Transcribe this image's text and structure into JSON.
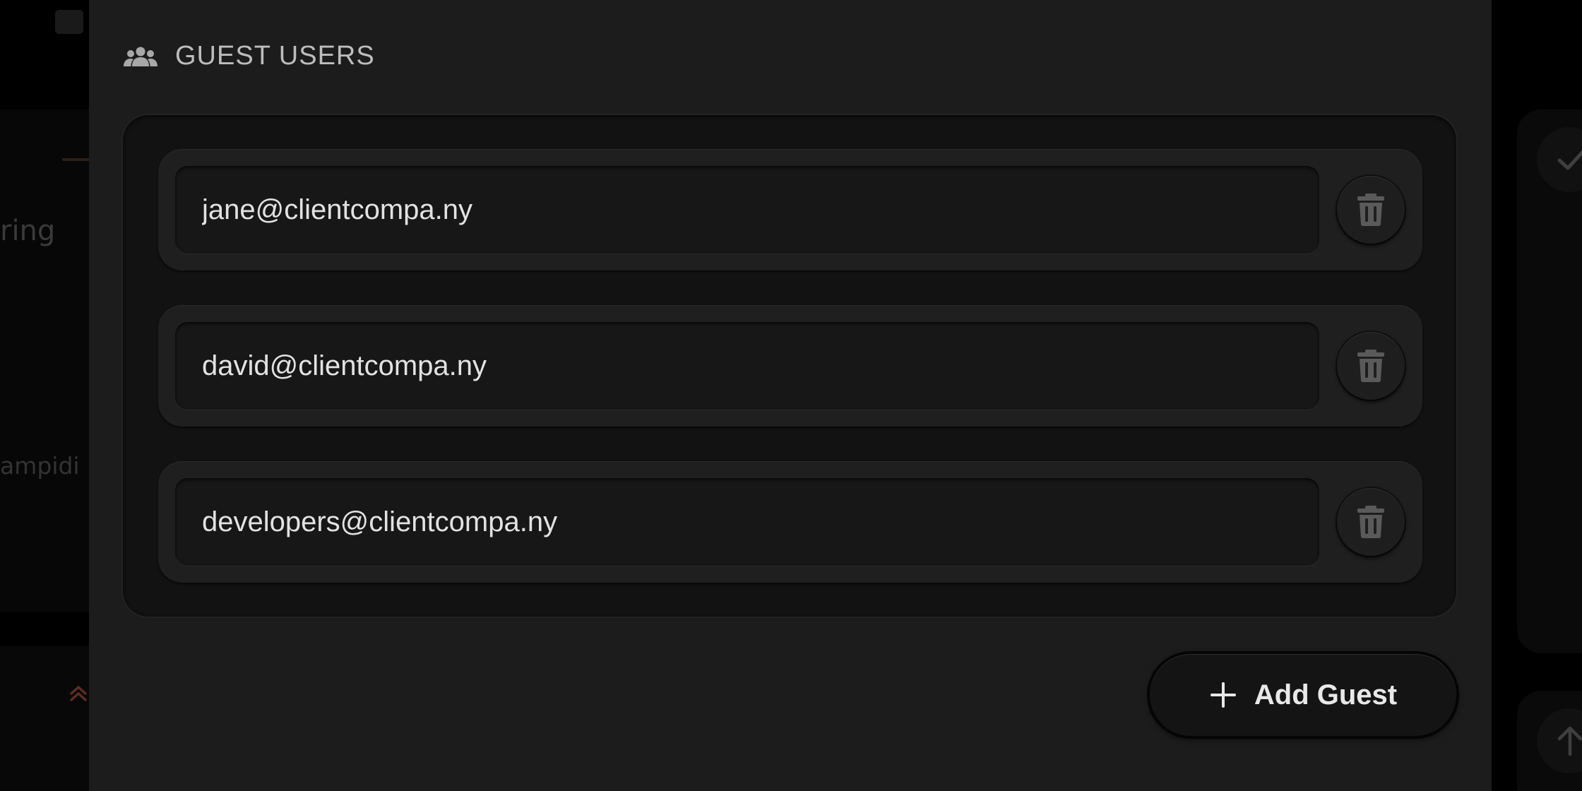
{
  "background": {
    "left_fragment_1": "ring",
    "left_fragment_2": "ampidi"
  },
  "section": {
    "title": "GUEST USERS",
    "icon": "group-icon"
  },
  "guests": [
    {
      "email": "jane@clientcompa.ny",
      "delete_icon": "trash-icon"
    },
    {
      "email": "david@clientcompa.ny",
      "delete_icon": "trash-icon"
    },
    {
      "email": "developers@clientcompa.ny",
      "delete_icon": "trash-icon"
    }
  ],
  "actions": {
    "add_label": "Add Guest",
    "add_icon": "plus-icon"
  },
  "colors": {
    "panel": "#1c1c1c",
    "list_well": "#121212",
    "row": "#1f1f1f",
    "text": "#e2e2e2",
    "icon_muted": "#5a5a5a"
  }
}
